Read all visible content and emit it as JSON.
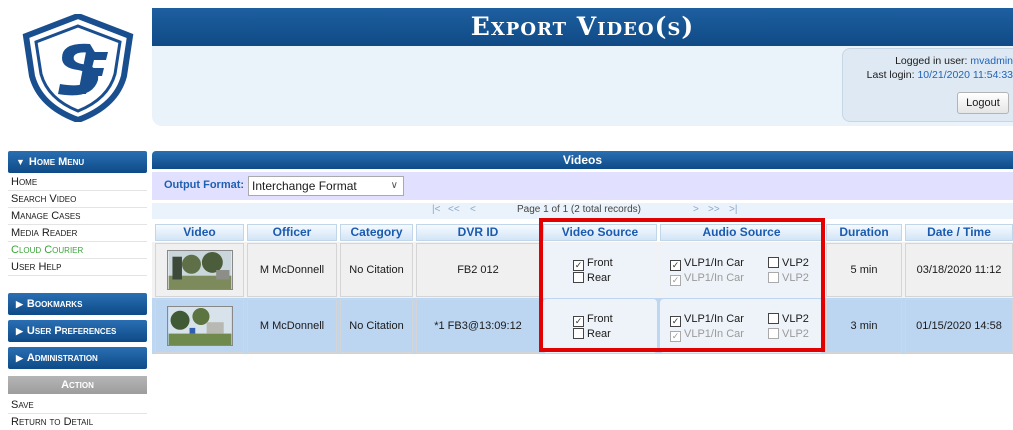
{
  "header": {
    "title": "Export Video(s)",
    "login": {
      "user_label": "Logged in user:",
      "user": "mvadmin",
      "last_login_label": "Last login:",
      "last_login": "10/21/2020 11:54:33",
      "logout": "Logout"
    }
  },
  "sidebar": {
    "home_menu": "Home Menu",
    "items": [
      "Home",
      "Search Video",
      "Manage Cases",
      "Media Reader",
      "Cloud Courier",
      "User Help"
    ],
    "bookmarks": "Bookmarks",
    "user_preferences": "User Preferences",
    "administration": "Administration",
    "action": "Action",
    "action_items": [
      "Save",
      "Return to Detail"
    ]
  },
  "main": {
    "section_title": "Videos",
    "output_format_label": "Output Format:",
    "output_format_value": "Interchange Format",
    "pager": {
      "first": "|<",
      "prev_page": "<<",
      "prev": "<",
      "info": "Page 1 of 1 (2 total records)",
      "next": ">",
      "next_page": ">>",
      "last": ">|"
    },
    "columns": [
      "Video",
      "Officer",
      "Category",
      "DVR ID",
      "Video Source",
      "Audio Source",
      "Duration",
      "Date / Time"
    ],
    "rows": [
      {
        "officer": "M McDonnell",
        "category": "No Citation",
        "dvr_id": "FB2 012",
        "video_sources": [
          {
            "label": "Front",
            "checked": true
          },
          {
            "label": "Rear",
            "checked": false
          }
        ],
        "audio_sources": [
          {
            "label": "VLP1/In Car",
            "checked": true
          },
          {
            "label": "VLP2",
            "checked": false
          },
          {
            "label": "VLP1/In Car",
            "checked": true,
            "disabled": true
          },
          {
            "label": "VLP2",
            "checked": false,
            "disabled": true
          }
        ],
        "duration": "5 min",
        "datetime": "03/18/2020 11:12"
      },
      {
        "officer": "M McDonnell",
        "category": "No Citation",
        "dvr_id": "*1 FB3@13:09:12",
        "video_sources": [
          {
            "label": "Front",
            "checked": true
          },
          {
            "label": "Rear",
            "checked": false
          }
        ],
        "audio_sources": [
          {
            "label": "VLP1/In Car",
            "checked": true
          },
          {
            "label": "VLP2",
            "checked": false
          },
          {
            "label": "VLP1/In Car",
            "checked": true,
            "disabled": true
          },
          {
            "label": "VLP2",
            "checked": false,
            "disabled": true
          }
        ],
        "duration": "3 min",
        "datetime": "01/15/2020 14:58"
      }
    ]
  },
  "colors": {
    "header_blue": "#104a85",
    "link_blue": "#1f63b8",
    "row_selected": "#bdd7f2",
    "highlight": "#e20000",
    "cloud_courier": "#3aa53a"
  }
}
